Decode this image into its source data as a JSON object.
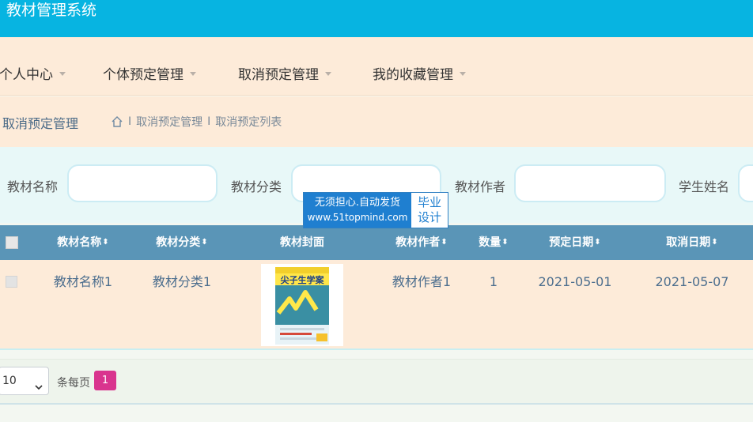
{
  "app": {
    "title": "教材管理系统"
  },
  "nav": {
    "items": [
      {
        "label": "个人中心"
      },
      {
        "label": "个体预定管理"
      },
      {
        "label": "取消预定管理"
      },
      {
        "label": "我的收藏管理"
      }
    ]
  },
  "breadcrumb": {
    "title": "取消预定管理",
    "items": [
      "取消预定管理",
      "取消预定列表"
    ],
    "separator": "I"
  },
  "search": {
    "fields": [
      {
        "label": "教材名称",
        "value": ""
      },
      {
        "label": "教材分类",
        "value": ""
      },
      {
        "label": "教材作者",
        "value": ""
      },
      {
        "label": "学生姓名",
        "value": ""
      }
    ]
  },
  "watermark": {
    "line1": "无须担心.自动发货",
    "line2": "www.51topmind.com",
    "right1": "毕业",
    "right2": "设计"
  },
  "table": {
    "headers": [
      "教材名称",
      "教材分类",
      "教材封面",
      "教材作者",
      "数量",
      "预定日期",
      "取消日期"
    ],
    "sort_glyph": "⬍",
    "rows": [
      {
        "name": "教材名称1",
        "category": "教材分类1",
        "cover_title": "尖子生学案",
        "author": "教材作者1",
        "quantity": "1",
        "reserve_date": "2021-05-01",
        "cancel_date": "2021-05-07"
      }
    ]
  },
  "pager": {
    "page_size": "10",
    "per_page_label": "条每页",
    "current_page": "1"
  },
  "colors": {
    "topbar": "#07b4e1",
    "nav_bg": "#fdebd9",
    "table_header": "#5a95b7",
    "page_active": "#d9348e"
  }
}
